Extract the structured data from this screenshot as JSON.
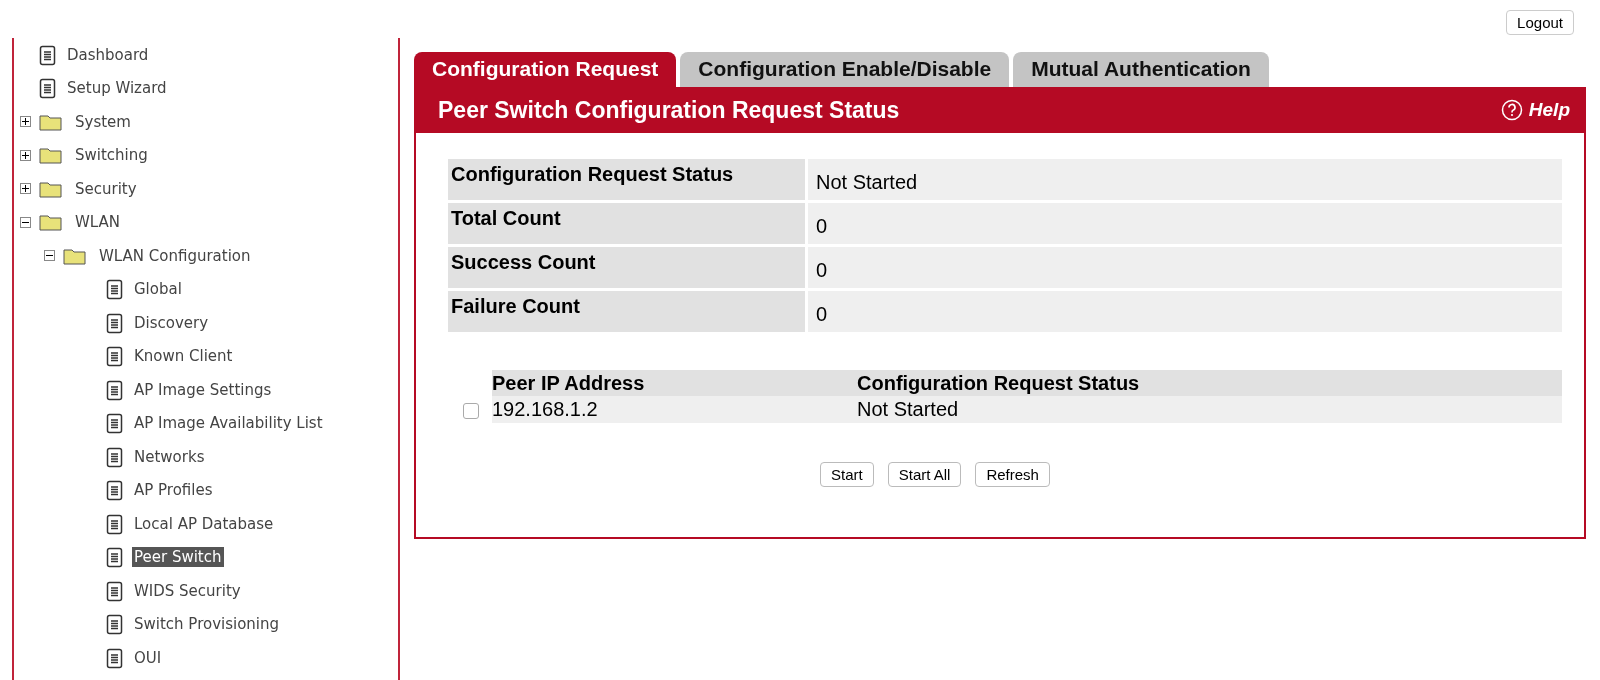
{
  "logout_button": "Logout",
  "sidebar": {
    "items": [
      {
        "label": "Dashboard",
        "kind": "page",
        "selected": false
      },
      {
        "label": "Setup Wizard",
        "kind": "page",
        "selected": false
      },
      {
        "label": "System",
        "kind": "folder",
        "expanded": false
      },
      {
        "label": "Switching",
        "kind": "folder",
        "expanded": false
      },
      {
        "label": "Security",
        "kind": "folder",
        "expanded": false
      },
      {
        "label": "WLAN",
        "kind": "folder",
        "expanded": true,
        "children": [
          {
            "label": "WLAN Configuration",
            "kind": "folder",
            "expanded": true,
            "children": [
              {
                "label": "Global",
                "kind": "page",
                "selected": false
              },
              {
                "label": "Discovery",
                "kind": "page",
                "selected": false
              },
              {
                "label": "Known Client",
                "kind": "page",
                "selected": false
              },
              {
                "label": "AP Image Settings",
                "kind": "page",
                "selected": false
              },
              {
                "label": "AP Image Availability List",
                "kind": "page",
                "selected": false
              },
              {
                "label": "Networks",
                "kind": "page",
                "selected": false
              },
              {
                "label": "AP Profiles",
                "kind": "page",
                "selected": false
              },
              {
                "label": "Local AP Database",
                "kind": "page",
                "selected": false
              },
              {
                "label": "Peer Switch",
                "kind": "page",
                "selected": true
              },
              {
                "label": "WIDS Security",
                "kind": "page",
                "selected": false
              },
              {
                "label": "Switch Provisioning",
                "kind": "page",
                "selected": false
              },
              {
                "label": "OUI",
                "kind": "page",
                "selected": false
              }
            ]
          }
        ]
      }
    ]
  },
  "tabs": [
    {
      "label": "Configuration Request",
      "selected": true
    },
    {
      "label": "Configuration Enable/Disable",
      "selected": false
    },
    {
      "label": "Mutual Authentication",
      "selected": false
    }
  ],
  "panel": {
    "title": "Peer Switch Configuration Request Status",
    "help": "Help",
    "fields": [
      {
        "label": "Configuration Request Status",
        "value": "Not Started"
      },
      {
        "label": "Total Count",
        "value": "0"
      },
      {
        "label": "Success Count",
        "value": "0"
      },
      {
        "label": "Failure Count",
        "value": "0"
      }
    ],
    "table": {
      "columns": [
        "Peer IP Address",
        "Configuration Request Status"
      ],
      "rows": [
        {
          "checked": false,
          "cells": [
            "192.168.1.2",
            "Not Started"
          ]
        }
      ]
    },
    "buttons": [
      "Start",
      "Start All",
      "Refresh"
    ]
  }
}
